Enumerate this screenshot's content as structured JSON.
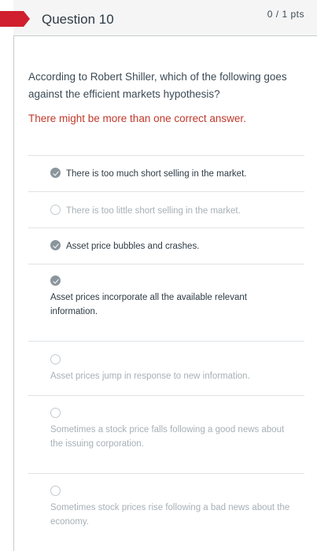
{
  "question": {
    "title": "Question 10",
    "points": "0 / 1 pts",
    "prompt": "According to Robert Shiller, which of the following goes against the efficient markets hypothesis?",
    "note": "There  might be more than one correct answer."
  },
  "answers": [
    {
      "text": "There is too much short selling in the market.",
      "checked": true
    },
    {
      "text": "There is too little short selling in the market.",
      "checked": false
    },
    {
      "text": "Asset price bubbles and crashes.",
      "checked": true
    },
    {
      "text": "Asset prices incorporate all the available relevant information.",
      "checked": true
    },
    {
      "text": "Asset prices jump in response to new information.",
      "checked": false
    },
    {
      "text": "Sometimes a stock price falls following a good news about the issuing corporation.",
      "checked": false
    },
    {
      "text": "Sometimes stock prices rise following a bad news about the economy.",
      "checked": false
    }
  ],
  "colors": {
    "flag": "#d01f2e",
    "note": "#c0392b",
    "checked": "#8a959c"
  }
}
